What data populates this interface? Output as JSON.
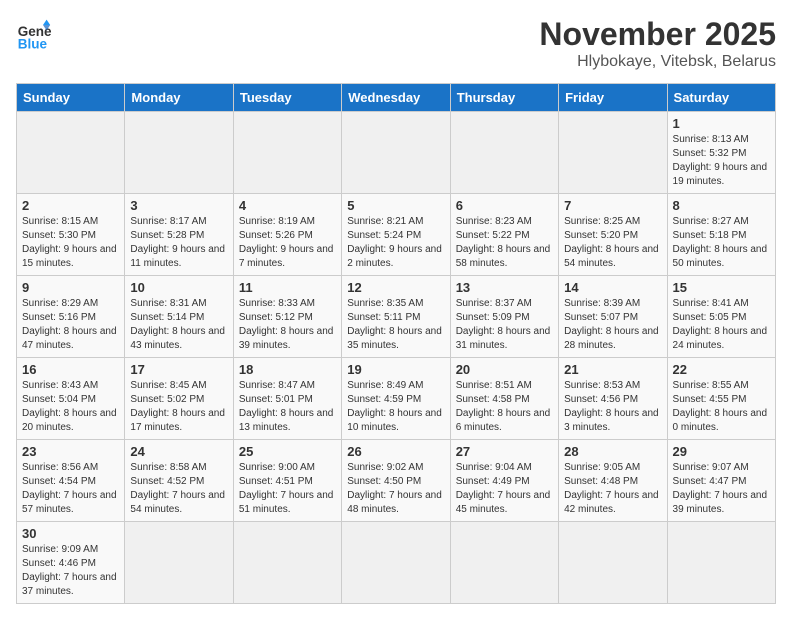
{
  "header": {
    "logo_general": "General",
    "logo_blue": "Blue",
    "month_title": "November 2025",
    "location": "Hlybokaye, Vitebsk, Belarus"
  },
  "days_of_week": [
    "Sunday",
    "Monday",
    "Tuesday",
    "Wednesday",
    "Thursday",
    "Friday",
    "Saturday"
  ],
  "weeks": [
    [
      {
        "day": "",
        "info": ""
      },
      {
        "day": "",
        "info": ""
      },
      {
        "day": "",
        "info": ""
      },
      {
        "day": "",
        "info": ""
      },
      {
        "day": "",
        "info": ""
      },
      {
        "day": "",
        "info": ""
      },
      {
        "day": "1",
        "info": "Sunrise: 8:13 AM\nSunset: 5:32 PM\nDaylight: 9 hours and 19 minutes."
      }
    ],
    [
      {
        "day": "2",
        "info": "Sunrise: 8:15 AM\nSunset: 5:30 PM\nDaylight: 9 hours and 15 minutes."
      },
      {
        "day": "3",
        "info": "Sunrise: 8:17 AM\nSunset: 5:28 PM\nDaylight: 9 hours and 11 minutes."
      },
      {
        "day": "4",
        "info": "Sunrise: 8:19 AM\nSunset: 5:26 PM\nDaylight: 9 hours and 7 minutes."
      },
      {
        "day": "5",
        "info": "Sunrise: 8:21 AM\nSunset: 5:24 PM\nDaylight: 9 hours and 2 minutes."
      },
      {
        "day": "6",
        "info": "Sunrise: 8:23 AM\nSunset: 5:22 PM\nDaylight: 8 hours and 58 minutes."
      },
      {
        "day": "7",
        "info": "Sunrise: 8:25 AM\nSunset: 5:20 PM\nDaylight: 8 hours and 54 minutes."
      },
      {
        "day": "8",
        "info": "Sunrise: 8:27 AM\nSunset: 5:18 PM\nDaylight: 8 hours and 50 minutes."
      }
    ],
    [
      {
        "day": "9",
        "info": "Sunrise: 8:29 AM\nSunset: 5:16 PM\nDaylight: 8 hours and 47 minutes."
      },
      {
        "day": "10",
        "info": "Sunrise: 8:31 AM\nSunset: 5:14 PM\nDaylight: 8 hours and 43 minutes."
      },
      {
        "day": "11",
        "info": "Sunrise: 8:33 AM\nSunset: 5:12 PM\nDaylight: 8 hours and 39 minutes."
      },
      {
        "day": "12",
        "info": "Sunrise: 8:35 AM\nSunset: 5:11 PM\nDaylight: 8 hours and 35 minutes."
      },
      {
        "day": "13",
        "info": "Sunrise: 8:37 AM\nSunset: 5:09 PM\nDaylight: 8 hours and 31 minutes."
      },
      {
        "day": "14",
        "info": "Sunrise: 8:39 AM\nSunset: 5:07 PM\nDaylight: 8 hours and 28 minutes."
      },
      {
        "day": "15",
        "info": "Sunrise: 8:41 AM\nSunset: 5:05 PM\nDaylight: 8 hours and 24 minutes."
      }
    ],
    [
      {
        "day": "16",
        "info": "Sunrise: 8:43 AM\nSunset: 5:04 PM\nDaylight: 8 hours and 20 minutes."
      },
      {
        "day": "17",
        "info": "Sunrise: 8:45 AM\nSunset: 5:02 PM\nDaylight: 8 hours and 17 minutes."
      },
      {
        "day": "18",
        "info": "Sunrise: 8:47 AM\nSunset: 5:01 PM\nDaylight: 8 hours and 13 minutes."
      },
      {
        "day": "19",
        "info": "Sunrise: 8:49 AM\nSunset: 4:59 PM\nDaylight: 8 hours and 10 minutes."
      },
      {
        "day": "20",
        "info": "Sunrise: 8:51 AM\nSunset: 4:58 PM\nDaylight: 8 hours and 6 minutes."
      },
      {
        "day": "21",
        "info": "Sunrise: 8:53 AM\nSunset: 4:56 PM\nDaylight: 8 hours and 3 minutes."
      },
      {
        "day": "22",
        "info": "Sunrise: 8:55 AM\nSunset: 4:55 PM\nDaylight: 8 hours and 0 minutes."
      }
    ],
    [
      {
        "day": "23",
        "info": "Sunrise: 8:56 AM\nSunset: 4:54 PM\nDaylight: 7 hours and 57 minutes."
      },
      {
        "day": "24",
        "info": "Sunrise: 8:58 AM\nSunset: 4:52 PM\nDaylight: 7 hours and 54 minutes."
      },
      {
        "day": "25",
        "info": "Sunrise: 9:00 AM\nSunset: 4:51 PM\nDaylight: 7 hours and 51 minutes."
      },
      {
        "day": "26",
        "info": "Sunrise: 9:02 AM\nSunset: 4:50 PM\nDaylight: 7 hours and 48 minutes."
      },
      {
        "day": "27",
        "info": "Sunrise: 9:04 AM\nSunset: 4:49 PM\nDaylight: 7 hours and 45 minutes."
      },
      {
        "day": "28",
        "info": "Sunrise: 9:05 AM\nSunset: 4:48 PM\nDaylight: 7 hours and 42 minutes."
      },
      {
        "day": "29",
        "info": "Sunrise: 9:07 AM\nSunset: 4:47 PM\nDaylight: 7 hours and 39 minutes."
      }
    ],
    [
      {
        "day": "30",
        "info": "Sunrise: 9:09 AM\nSunset: 4:46 PM\nDaylight: 7 hours and 37 minutes."
      },
      {
        "day": "",
        "info": ""
      },
      {
        "day": "",
        "info": ""
      },
      {
        "day": "",
        "info": ""
      },
      {
        "day": "",
        "info": ""
      },
      {
        "day": "",
        "info": ""
      },
      {
        "day": "",
        "info": ""
      }
    ]
  ]
}
